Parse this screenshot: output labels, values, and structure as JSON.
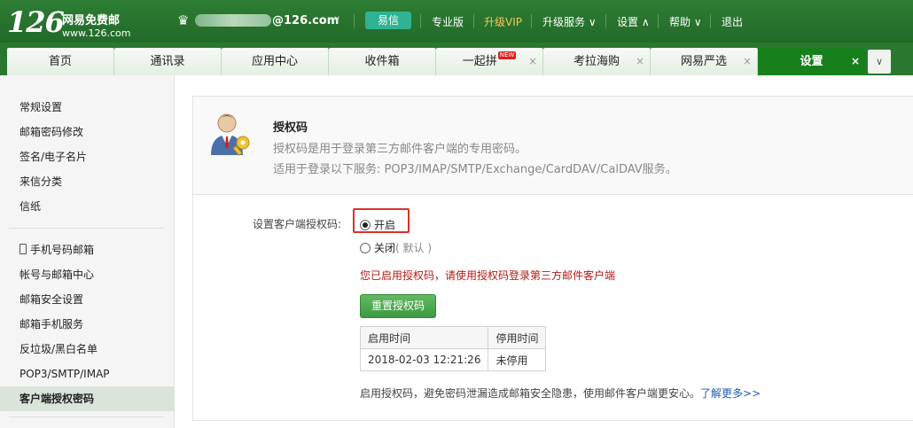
{
  "header": {
    "logo_number": "126",
    "logo_name": "网易免费邮",
    "logo_domain": "www.126.com",
    "account_suffix": "@126.com",
    "links": [
      "专业版",
      "升级VIP",
      "升级服务",
      "设置",
      "帮助",
      "退出"
    ],
    "yixin_label": "易信",
    "icons": {
      "crown": "crown-icon",
      "caret": "chevron-down-icon"
    },
    "colors": {
      "brand": "#226a29",
      "vip": "#f8c45d",
      "yixin": "#2fb392"
    }
  },
  "tabs": [
    {
      "label": "首页"
    },
    {
      "label": "通讯录"
    },
    {
      "label": "应用中心"
    },
    {
      "label": "收件箱"
    },
    {
      "label": "一起拼",
      "badge": "NEW"
    },
    {
      "label": "考拉海购"
    },
    {
      "label": "网易严选"
    },
    {
      "label": "设置"
    }
  ],
  "tab_close_glyph": "×",
  "sidebar": {
    "group1": [
      "常规设置",
      "邮箱密码修改",
      "签名/电子名片",
      "来信分类",
      "信纸"
    ],
    "group2": [
      "手机号码邮箱",
      "帐号与邮箱中心",
      "邮箱安全设置",
      "邮箱手机服务",
      "反垃圾/黑白名单",
      "POP3/SMTP/IMAP",
      "客户端授权密码"
    ]
  },
  "auth": {
    "title": "授权码",
    "desc1": "授权码是用于登录第三方邮件客户端的专用密码。",
    "desc2": "适用于登录以下服务: POP3/IMAP/SMTP/Exchange/CardDAV/CalDAV服务。",
    "setting_label": "设置客户端授权码:",
    "option_on": "开启",
    "option_off": "关闭",
    "option_off_note": "( 默认 )",
    "selected": "开启",
    "enabled_message": "您已启用授权码，请使用授权码登录第三方邮件客户端",
    "reset_button": "重置授权码",
    "table_headers": [
      "启用时间",
      "停用时间"
    ],
    "table_row": [
      "2018-02-03 12:21:26",
      "未停用"
    ],
    "footnote": "启用授权码，避免密码泄漏造成邮箱安全隐患，使用邮件客户端更安心。",
    "learn_more": "了解更多>>",
    "highlight_color": "#d8322d"
  }
}
